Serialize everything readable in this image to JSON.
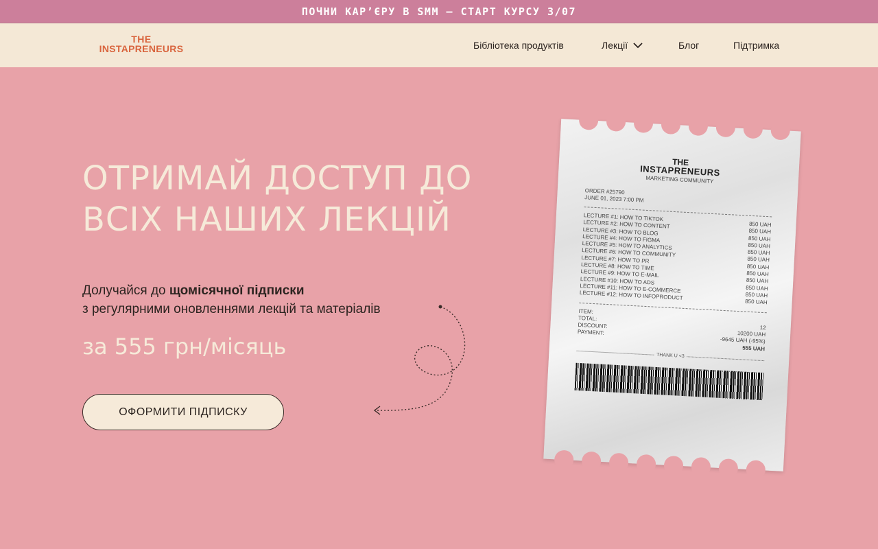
{
  "announcement": {
    "text": "ПОЧНИ КАР’ЄРУ В SMM — СТАРТ КУРСУ 3/07"
  },
  "header": {
    "logo_line1": "THE",
    "logo_line2": "INSTAPRENEURS",
    "nav": {
      "library": "Бібліотека продуктів",
      "lectures": "Лекції",
      "blog": "Блог",
      "support": "Підтримка"
    }
  },
  "hero": {
    "title_line1": "ОТРИМАЙ ДОСТУП ДО",
    "title_line2": "ВСІХ НАШИХ ЛЕКЦІЙ",
    "subtitle_prefix": "Долучайся до ",
    "subtitle_bold": "щомісячної підписки",
    "subtitle_line2": "з регулярними оновленнями лекцій та матеріалів",
    "price": "за 555 грн/місяць",
    "cta_label": "ОФОРМИТИ ПІДПИСКУ"
  },
  "receipt": {
    "brand_line1": "THE",
    "brand_line2": "INSTAPRENEURS",
    "brand_line3": "MARKETING COMMUNITY",
    "order": "ORDER #25790",
    "date": "JUNE 01, 2023 7:00 PM",
    "items": [
      {
        "name": "LECTURE #1: HOW TO TIKTOK",
        "price": "850 UAH"
      },
      {
        "name": "LECTURE #2: HOW TO CONTENT",
        "price": "850 UAH"
      },
      {
        "name": "LECTURE #3: HOW TO BLOG",
        "price": "850 UAH"
      },
      {
        "name": "LECTURE #4: HOW TO FIGMA",
        "price": "850 UAH"
      },
      {
        "name": "LECTURE #5: HOW TO  ANALYTICS",
        "price": "850 UAH"
      },
      {
        "name": "LECTURE #6: HOW TO COMMUNITY",
        "price": "850 UAH"
      },
      {
        "name": "LECTURE #7: HOW TO PR",
        "price": "850 UAH"
      },
      {
        "name": "LECTURE #8: HOW TO TIME",
        "price": "850 UAH"
      },
      {
        "name": "LECTURE #9: HOW TO E-MAIL",
        "price": "850 UAH"
      },
      {
        "name": "LECTURE #10: HOW TO ADS",
        "price": "850 UAH"
      },
      {
        "name": "LECTURE #11: HOW TO E-COMMERCE",
        "price": "850 UAH"
      },
      {
        "name": "LECTURE #12: HOW TO INFOPRODUCT",
        "price": "850 UAH"
      }
    ],
    "summary": [
      {
        "label": "ITEM:",
        "value": ""
      },
      {
        "label": "TOTAL:",
        "value": "12"
      },
      {
        "label": "DISCOUNT:",
        "value": "10200 UAH"
      },
      {
        "label": "PAYMENT:",
        "value": "-9645 UAH (-95%)"
      },
      {
        "label": "",
        "value": "555 UAH"
      }
    ],
    "thanks": "THANK U <3"
  },
  "colors": {
    "background": "#e8a2a8",
    "topbar": "#cc7f9b",
    "nav": "#f4e8d6",
    "logo": "#d9643d",
    "cream": "#f6ead9"
  }
}
